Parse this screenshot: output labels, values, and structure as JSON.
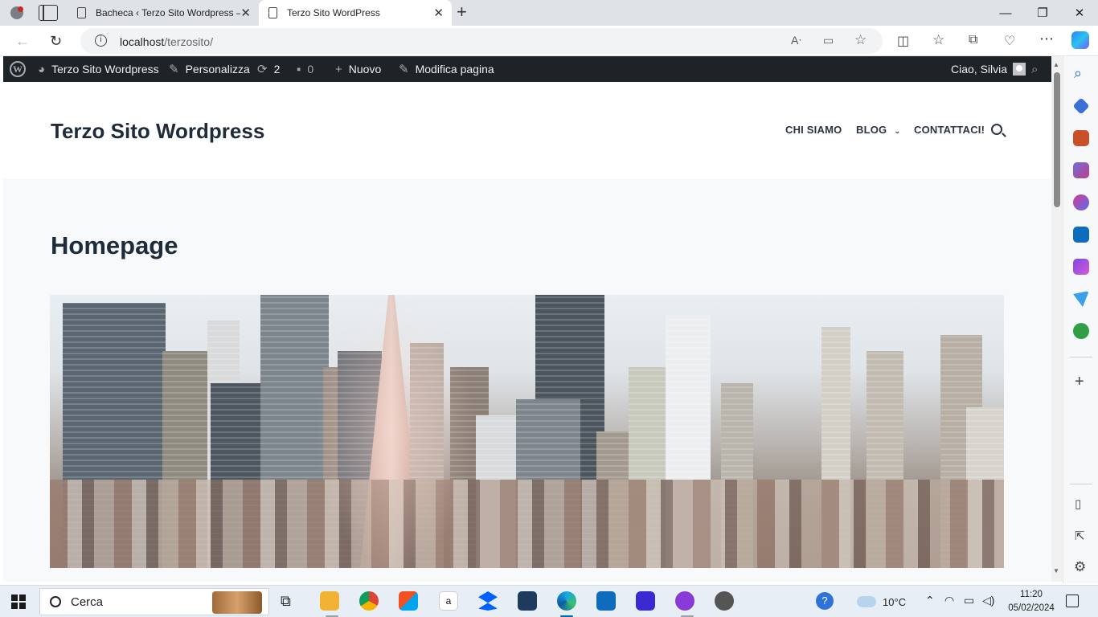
{
  "browser": {
    "tabs": [
      {
        "title": "Bacheca ‹ Terzo Sito Wordpress —",
        "active": false
      },
      {
        "title": "Terzo Sito WordPress",
        "active": true
      }
    ],
    "address": {
      "host": "localhost",
      "path": "/terzosito/"
    }
  },
  "wp_admin_bar": {
    "site_name": "Terzo Sito Wordpress",
    "customize": "Personalizza",
    "updates_count": "2",
    "comments_count": "0",
    "new": "Nuovo",
    "edit_page": "Modifica pagina",
    "greeting": "Ciao, Silvia"
  },
  "site": {
    "title": "Terzo Sito Wordpress",
    "menu": [
      "CHI SIAMO",
      "BLOG",
      "CONTATTACI!"
    ],
    "page_title": "Homepage"
  },
  "taskbar": {
    "search_placeholder": "Cerca",
    "weather": "10°C",
    "time": "11:20",
    "date": "05/02/2024"
  },
  "colors": {
    "wp_admin_bar": "#1d2327",
    "page_background": "#f8f9fb",
    "heading": "#1e2b3a"
  }
}
